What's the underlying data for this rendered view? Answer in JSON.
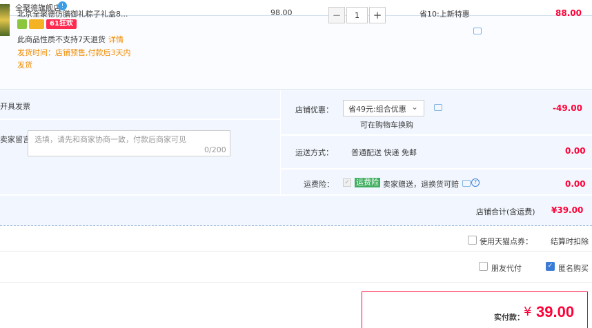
{
  "shop": {
    "name": "铺：全聚德旗舰店",
    "badge": "!"
  },
  "product": {
    "title": "北京全聚德仿膳御礼粽子礼盒8...",
    "tag_61": "61狂欢",
    "no_return": "此商品性质不支持7天退货",
    "detail_link": "详情",
    "ship_time": "发货时间：店铺预售,付款后3天内",
    "ship_time_2": "发货",
    "price": "98.00",
    "quantity": "1",
    "qty_minus": "−",
    "qty_plus": "+",
    "promo": "省10:上新特惠",
    "subtotal": "88.00"
  },
  "options": {
    "invoice": "开具发票",
    "message_label": "卖家留言：",
    "message_placeholder": "选填，请先和商家协商一致，付款后商家可见",
    "message_count": "0/200",
    "coupon_label": "店铺优惠：",
    "coupon_selected": "省49元:组合优惠",
    "coupon_tip": "可在购物车换购",
    "coupon_amount": "-49.00",
    "shipping_label": "运送方式：",
    "shipping_value": "普通配送 快递 免邮",
    "shipping_amount": "0.00",
    "insurance_label": "运费险：",
    "insurance_tag": "运费险",
    "insurance_desc": "卖家赠送，退换货可赔",
    "insurance_amount": "0.00"
  },
  "shop_total": {
    "label": "店铺合计(含运费)",
    "amount": "¥39.00"
  },
  "tmall_points": {
    "label": "使用天猫点券：",
    "deduct": "结算时扣除"
  },
  "friend_pay": {
    "label": "朋友代付",
    "checked": false
  },
  "anonymous": {
    "label": "匿名购买",
    "checked": true
  },
  "pay": {
    "label": "实付款：",
    "currency": "¥",
    "amount": "39.00"
  },
  "colors": {
    "accent_red": "#ff0036",
    "orange": "#f08c00",
    "panel_blue": "#f2f7ff",
    "check_blue": "#3a7bd5"
  }
}
